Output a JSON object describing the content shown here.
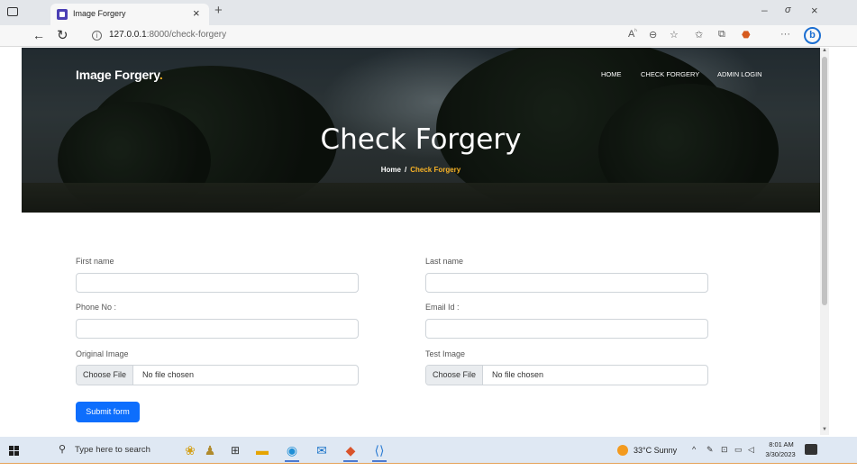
{
  "browser": {
    "tab_title": "Image Forgery",
    "tab_close": "×",
    "new_tab": "+",
    "url_host": "127.0.0.1",
    "url_path": ":8000/check-forgery",
    "window_min": "–",
    "window_restore": "σ",
    "window_close": "×"
  },
  "site": {
    "brand": "Image Forgery",
    "brand_dot": ".",
    "nav": [
      "HOME",
      "CHECK FORGERY",
      "ADMIN LOGIN"
    ],
    "hero_title": "Check Forgery",
    "breadcrumb_home": "Home",
    "breadcrumb_sep": "/",
    "breadcrumb_current": "Check Forgery",
    "accent_color": "#f6b126"
  },
  "form": {
    "first_name_label": "First name",
    "last_name_label": "Last name",
    "phone_label": "Phone No :",
    "email_label": "Email Id :",
    "original_image_label": "Original Image",
    "test_image_label": "Test Image",
    "choose_file": "Choose File",
    "no_file": "No file chosen",
    "submit": "Submit form",
    "submit_color": "#0d6efd"
  },
  "taskbar": {
    "search_placeholder": "Type here to search",
    "weather": "33°C  Sunny",
    "time": "8:01 AM",
    "date": "3/30/2023"
  }
}
